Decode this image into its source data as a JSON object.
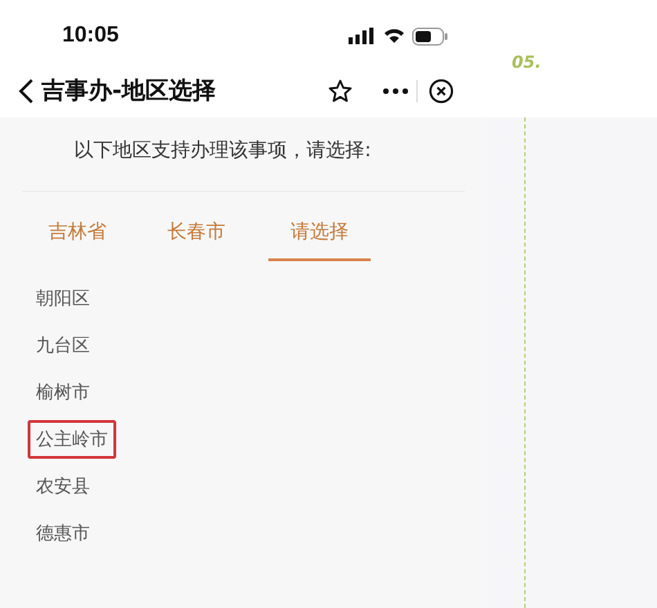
{
  "status_bar": {
    "time": "10:05"
  },
  "nav_bar": {
    "title": "吉事办-地区选择"
  },
  "side_note": {
    "label": "05."
  },
  "instruction": "以下地区支持办理该事项，请选择:",
  "tabs": [
    {
      "label": "吉林省",
      "selected": false
    },
    {
      "label": "长春市",
      "selected": false
    },
    {
      "label": "请选择",
      "selected": true
    }
  ],
  "regions": [
    {
      "label": "朝阳区",
      "highlighted": false
    },
    {
      "label": "九台区",
      "highlighted": false
    },
    {
      "label": "榆树市",
      "highlighted": false
    },
    {
      "label": "公主岭市",
      "highlighted": true
    },
    {
      "label": "农安县",
      "highlighted": false
    },
    {
      "label": "德惠市",
      "highlighted": false
    }
  ]
}
